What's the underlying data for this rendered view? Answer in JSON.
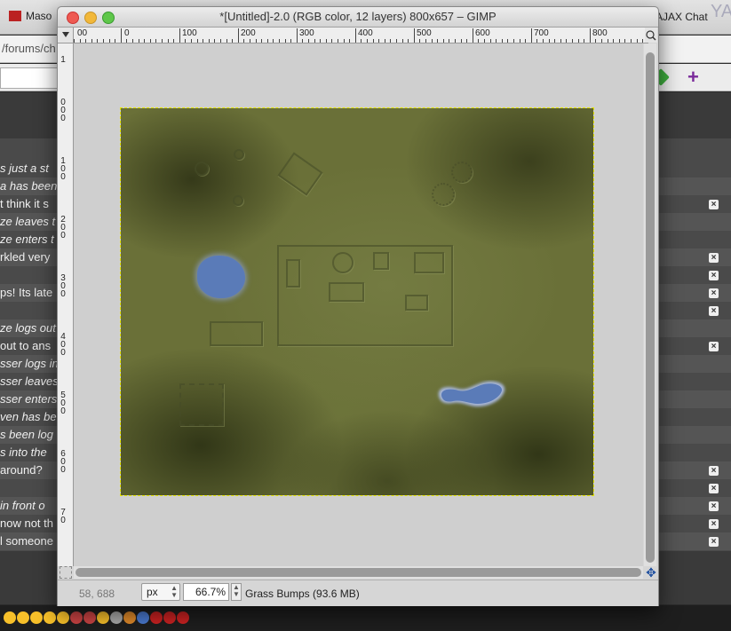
{
  "browser": {
    "tab1": "Maso",
    "tab_right": "AJAX Chat",
    "ya": "YA",
    "url": "/forums/ch"
  },
  "chat_lines": [
    {
      "text": "s just a st",
      "italic": true,
      "alt": false,
      "x": false
    },
    {
      "text": "a has been",
      "italic": true,
      "alt": true,
      "x": false
    },
    {
      "text": "t think it s",
      "italic": false,
      "alt": false,
      "x": true
    },
    {
      "text": "ze leaves t",
      "italic": true,
      "alt": true,
      "x": false
    },
    {
      "text": "ze enters t",
      "italic": true,
      "alt": false,
      "x": false
    },
    {
      "text": "rkled very",
      "italic": false,
      "alt": true,
      "x": true
    },
    {
      "text": "",
      "italic": false,
      "alt": false,
      "x": true
    },
    {
      "text": "ps! Its late",
      "italic": false,
      "alt": true,
      "x": true
    },
    {
      "text": "",
      "italic": false,
      "alt": false,
      "x": true
    },
    {
      "text": "ze logs out",
      "italic": true,
      "alt": true,
      "x": false
    },
    {
      "text": "out to ans",
      "italic": false,
      "alt": false,
      "x": true
    },
    {
      "text": "sser logs in",
      "italic": true,
      "alt": true,
      "x": false
    },
    {
      "text": "sser leaves",
      "italic": true,
      "alt": false,
      "x": false
    },
    {
      "text": "sser enters",
      "italic": true,
      "alt": true,
      "x": false
    },
    {
      "text": "ven has be",
      "italic": true,
      "alt": false,
      "x": false
    },
    {
      "text": "s been log",
      "italic": true,
      "alt": true,
      "x": false
    },
    {
      "text": "s into the",
      "italic": true,
      "alt": false,
      "x": false
    },
    {
      "text": " around?",
      "italic": false,
      "alt": true,
      "x": true
    },
    {
      "text": "",
      "italic": false,
      "alt": false,
      "x": true
    },
    {
      "text": " in front o",
      "italic": true,
      "alt": true,
      "x": true
    },
    {
      "text": "now not th",
      "italic": false,
      "alt": false,
      "x": true
    },
    {
      "text": "l someone",
      "italic": false,
      "alt": true,
      "x": true
    }
  ],
  "gimp": {
    "title": "*[Untitled]-2.0 (RGB color, 12 layers) 800x657 – GIMP",
    "ruler_top_labels": [
      "00",
      "0",
      "100",
      "200",
      "300",
      "400",
      "500",
      "600",
      "700",
      "800"
    ],
    "ruler_left_labels": [
      "1",
      "0",
      "0",
      "0",
      "1",
      "0",
      "0",
      "2",
      "0",
      "0",
      "3",
      "0",
      "0",
      "4",
      "0",
      "0",
      "5",
      "0",
      "0",
      "6",
      "0",
      "0",
      "7",
      "0"
    ],
    "coords": "58, 688",
    "unit": "px",
    "zoom": "66.7%",
    "status": "Grass Bumps (93.6 MB)"
  },
  "colors": {
    "accent_close": "#ee5a52",
    "accent_minimize": "#f2b83a",
    "accent_zoom": "#5fc74a",
    "water": "#5a7bb8",
    "grass": "#6a7038"
  }
}
